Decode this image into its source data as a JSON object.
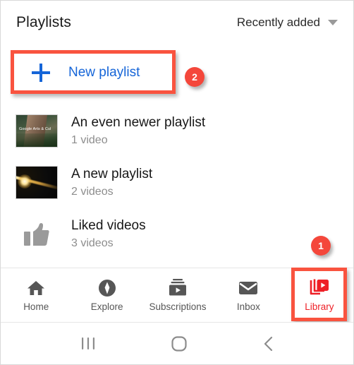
{
  "header": {
    "title": "Playlists",
    "sort": {
      "label": "Recently added",
      "caret_icon": "chevron-down-icon"
    }
  },
  "new_playlist": {
    "label": "New playlist",
    "plus_icon": "plus-icon",
    "accent_color": "#1565d8"
  },
  "annotations": {
    "highlight_color": "#f9533f",
    "badge_color": "#f4473b",
    "step_2": "2",
    "step_1": "1"
  },
  "playlists": [
    {
      "title": "An even newer playlist",
      "count": "1 video",
      "thumb_kind": "photo-arts-culture",
      "thumb_overlay_text": "Google Arts & Cul"
    },
    {
      "title": "A new playlist",
      "count": "2 videos",
      "thumb_kind": "photo-space-light",
      "thumb_overlay_text": ""
    },
    {
      "title": "Liked videos",
      "count": "3 videos",
      "thumb_kind": "thumbs-up-icon",
      "thumb_overlay_text": ""
    }
  ],
  "bottom_nav": {
    "items": [
      {
        "label": "Home",
        "icon": "home-icon",
        "active": false
      },
      {
        "label": "Explore",
        "icon": "compass-icon",
        "active": false
      },
      {
        "label": "Subscriptions",
        "icon": "subscriptions-icon",
        "active": false
      },
      {
        "label": "Inbox",
        "icon": "envelope-icon",
        "active": false
      },
      {
        "label": "Library",
        "icon": "library-icon",
        "active": true
      }
    ],
    "active_color": "#ee1f26",
    "inactive_color": "#565656"
  },
  "system_nav": {
    "recents_icon": "recents-icon",
    "home_icon": "home-circle-icon",
    "back_icon": "back-chevron-icon"
  }
}
